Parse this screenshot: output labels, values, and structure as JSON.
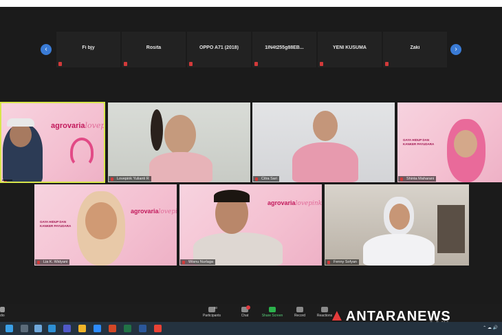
{
  "strip": {
    "prev_icon": "chevron-left-icon",
    "next_icon": "chevron-right-icon",
    "participants": [
      "Fi bjy",
      "Rosita",
      "OPPO A71 (2018)",
      "1IN4t255g88EB...",
      "YENI KUSUMA",
      "Zaki"
    ]
  },
  "video": {
    "presenter_brand": "agrovaria",
    "brand_suffix": "lovepink",
    "tagline_1": "GAYA HIDUP DAN",
    "tagline_2": "KANKER PAYUDARA",
    "tiles": [
      {
        "name": ""
      },
      {
        "name": "Lovepink Yulianti R"
      },
      {
        "name": "Citra Sari"
      },
      {
        "name": "Shinta Maharani"
      },
      {
        "name": "Lia K. Widyani"
      },
      {
        "name": "Wisnu Nurlaga"
      },
      {
        "name": "Fenny Sofyan"
      }
    ]
  },
  "toolbar": {
    "audio_label": "dio",
    "participants_label": "Participants",
    "participants_count": "30",
    "chat_label": "Chat",
    "share_label": "Share Screen",
    "record_label": "Record",
    "reactions_label": "Reactions"
  },
  "watermark": {
    "text": "ANTARANEWS",
    "suffix": ".com"
  },
  "colors": {
    "accent_pink": "#e24a86",
    "share_green": "#2bb24c",
    "nav_blue": "#3a7bd5"
  }
}
